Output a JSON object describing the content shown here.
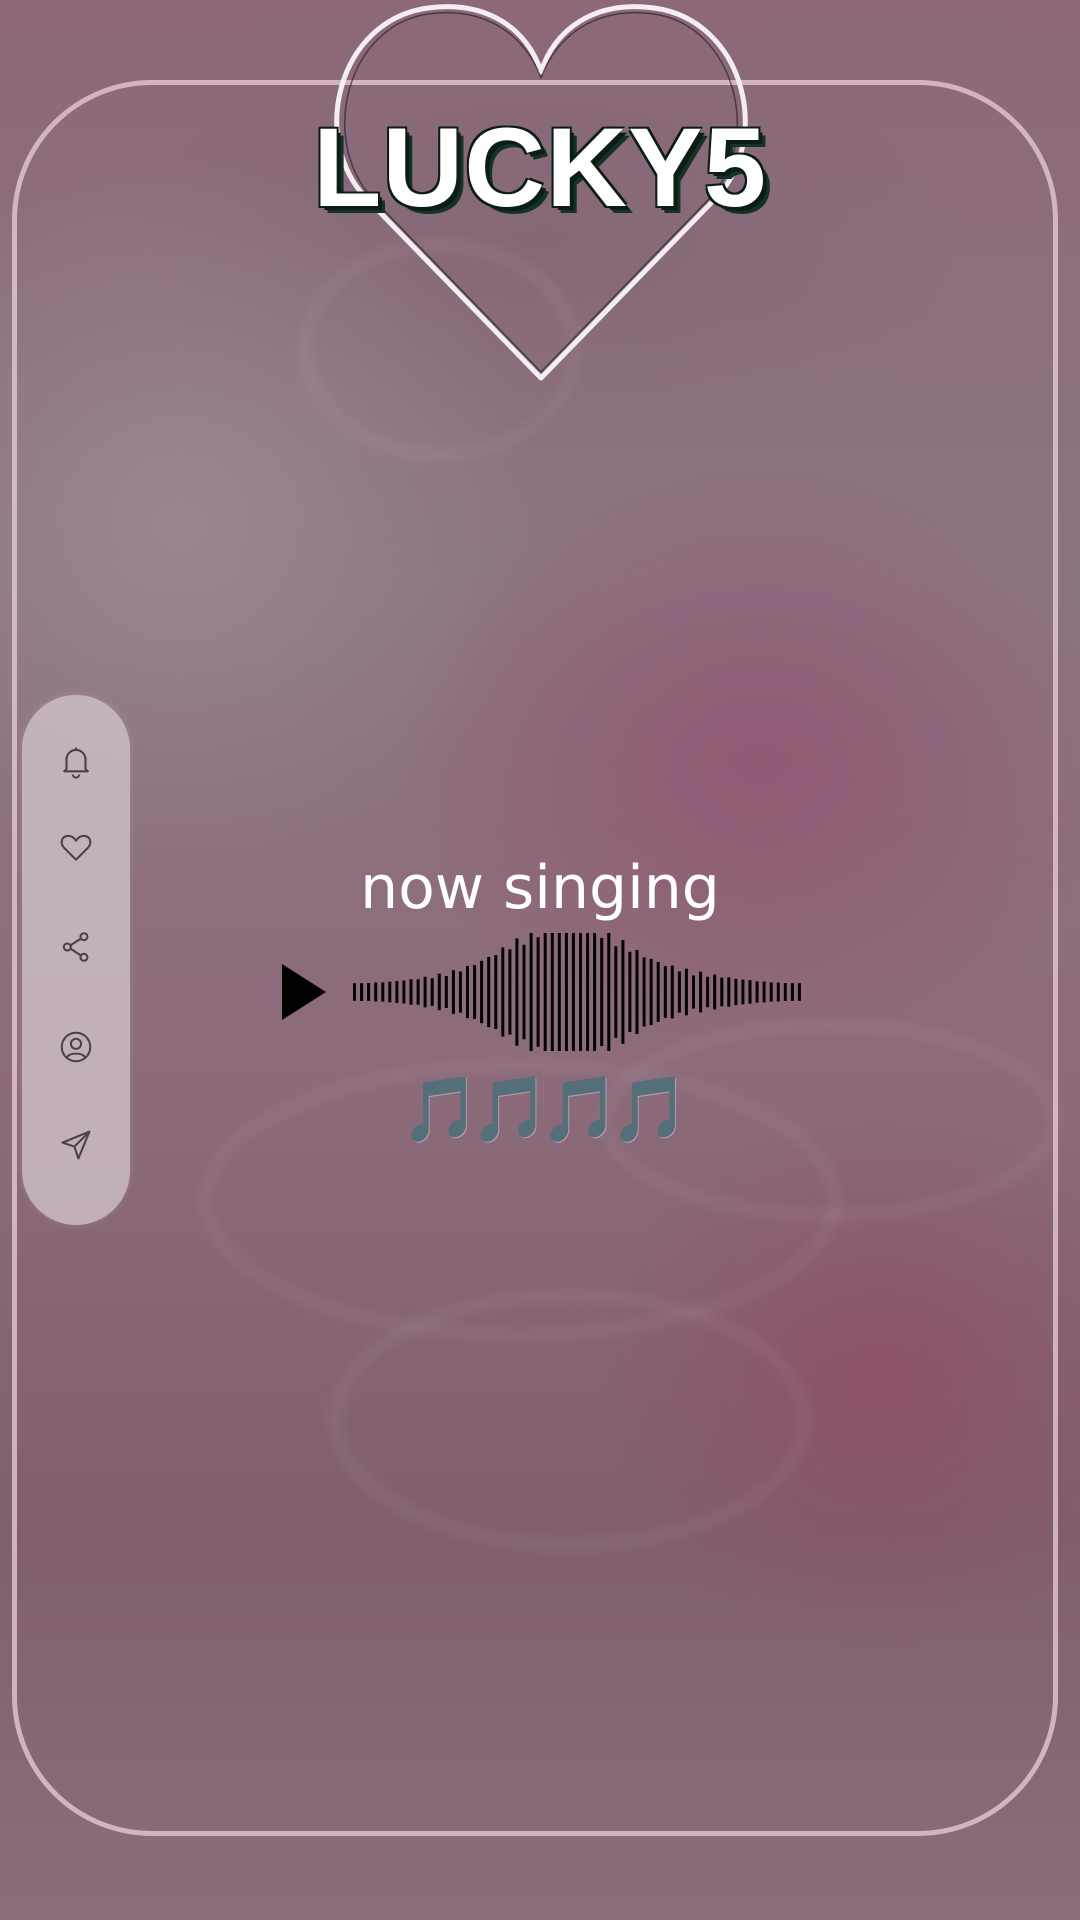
{
  "app": {
    "brand": "LUCKY5"
  },
  "player": {
    "status_label": "now singing",
    "notes": "🎵🎵🎵🎵",
    "play_icon": "play-icon"
  },
  "sidebar": {
    "items": [
      {
        "icon": "bell-icon"
      },
      {
        "icon": "heart-icon"
      },
      {
        "icon": "share-icon"
      },
      {
        "icon": "profile-icon"
      },
      {
        "icon": "send-icon"
      }
    ]
  },
  "colors": {
    "background": "#8a6775",
    "frame": "#e8cdda",
    "panel": "#cdc0c8",
    "icon_stroke": "#4a4048",
    "text": "#ffffff"
  }
}
